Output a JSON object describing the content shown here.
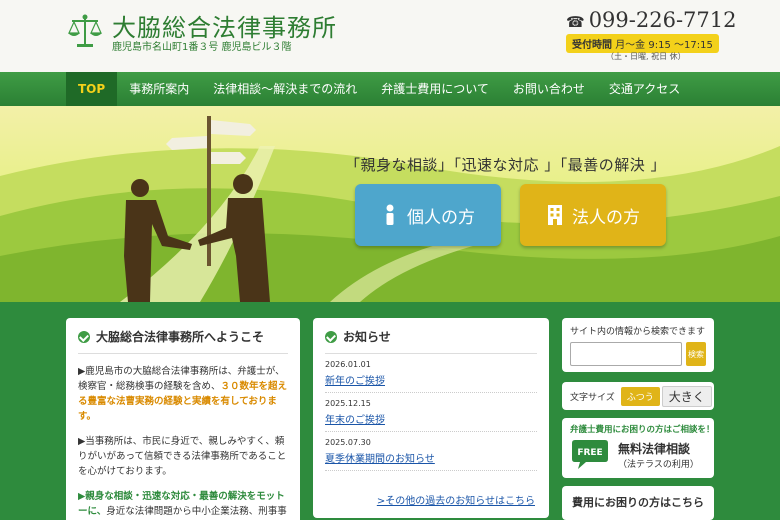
{
  "header": {
    "title": "大脇総合法律事務所",
    "address": "鹿児島市名山町1番３号  鹿児島ビル３階",
    "phone": "099-226-7712",
    "hours_label": "受付時間",
    "hours_value": "月～金 9:15 ～17:15",
    "closed": "（土・日曜, 祝日 休）"
  },
  "nav": {
    "items": [
      {
        "label": "TOP"
      },
      {
        "label": "事務所案内"
      },
      {
        "label": "法律相談～解決までの流れ"
      },
      {
        "label": "弁護士費用について"
      },
      {
        "label": "お問い合わせ"
      },
      {
        "label": "交通アクセス"
      }
    ]
  },
  "hero": {
    "tagline": "「親身な相談」「迅速な対応 」「最善の解決 」",
    "personal_label": "個人の方",
    "corporate_label": "法人の方"
  },
  "welcome": {
    "title": "大脇総合法律事務所へようこそ",
    "p1_a": "▶鹿児島市の大脇総合法律事務所は、弁護士が、検察官・総務検事の経験を含め、",
    "p1_b": "３０数年を超える豊富な法曹実務の経験と実績を有しております。",
    "p2": "▶当事務所は、市民に身近で、親しみやすく、頼りがいがあって信頼できる法律事務所であることを心がけております。",
    "p3_a": "▶親身な相談・迅速な対応・最善の解決をモットーに、",
    "p3_b": "身近な法律問題から中小企業法務、刑事事件まで幅広く対応しておりますので、お気"
  },
  "news": {
    "title": "お知らせ",
    "items": [
      {
        "date": "2026.01.01",
        "title": "新年のご挨拶"
      },
      {
        "date": "2025.12.15",
        "title": "年末のご挨拶"
      },
      {
        "date": "2025.07.30",
        "title": "夏季休業期間のお知らせ"
      }
    ],
    "more": ">その他の過去のお知らせはこちら"
  },
  "sidebar": {
    "search_label": "サイト内の情報から検索できます",
    "search_value": "",
    "search_placeholder": "",
    "search_button": "検索",
    "fontsize_label": "文字サイズ",
    "fontsize_normal": "ふつう",
    "fontsize_large": "大きく",
    "free_caption": "弁護士費用にお困りの方はご相談を！",
    "free_main": "無料法律相談",
    "free_sub": "（法テラスの利用）",
    "free_badge": "FREE",
    "cost_link": "費用にお困りの方はこちら"
  }
}
